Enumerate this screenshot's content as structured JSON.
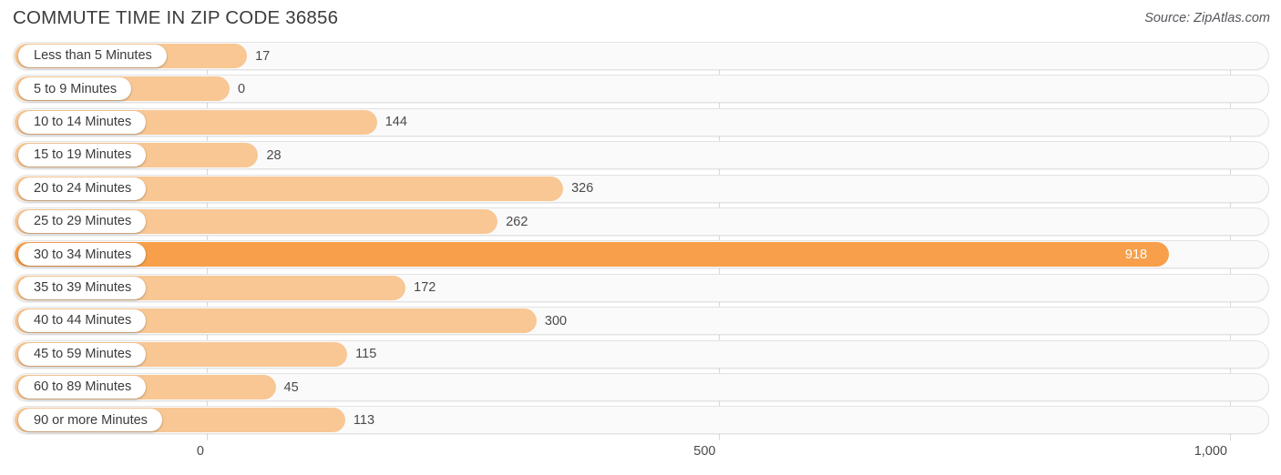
{
  "header": {
    "title": "COMMUTE TIME IN ZIP CODE 36856",
    "source": "Source: ZipAtlas.com"
  },
  "colors": {
    "bar": "#f8c794",
    "bar_max": "#f79f4a",
    "track": "#fafafa",
    "track_border": "#e3e3e3",
    "gridline": "#d9d9d9",
    "text": "#3b3b3b",
    "value_text": "#4a4a4a",
    "value_text_inside": "#ffffff"
  },
  "chart_data": {
    "type": "bar",
    "orientation": "horizontal",
    "title": "COMMUTE TIME IN ZIP CODE 36856",
    "subtitle": "Source: ZipAtlas.com",
    "xlabel": "",
    "ylabel": "",
    "xlim": [
      0,
      1000
    ],
    "grid": true,
    "legend": null,
    "tick_labels": [
      "0",
      "500",
      "1,000"
    ],
    "tick_values": [
      0,
      500,
      1000
    ],
    "categories": [
      "Less than 5 Minutes",
      "5 to 9 Minutes",
      "10 to 14 Minutes",
      "15 to 19 Minutes",
      "20 to 24 Minutes",
      "25 to 29 Minutes",
      "30 to 34 Minutes",
      "35 to 39 Minutes",
      "40 to 44 Minutes",
      "45 to 59 Minutes",
      "60 to 89 Minutes",
      "90 or more Minutes"
    ],
    "values": [
      17,
      0,
      144,
      28,
      326,
      262,
      918,
      172,
      300,
      115,
      45,
      113
    ],
    "value_labels": [
      "17",
      "0",
      "144",
      "28",
      "326",
      "262",
      "918",
      "172",
      "300",
      "115",
      "45",
      "113"
    ],
    "max_index": 6
  }
}
